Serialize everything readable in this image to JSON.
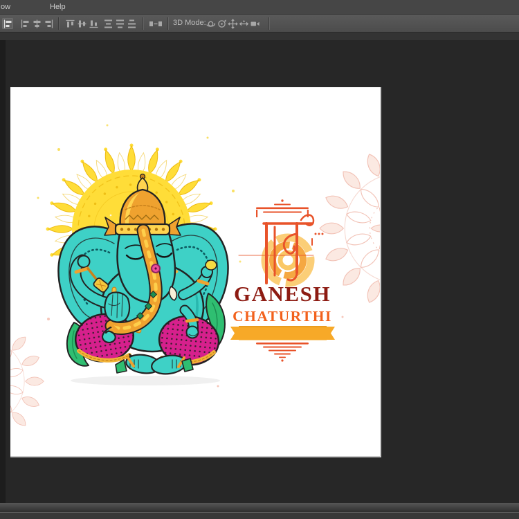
{
  "menu_bar": {
    "items": [
      {
        "label": "ow"
      },
      {
        "label": "Help"
      }
    ]
  },
  "options_bar": {
    "active_icon": "align-left-edges",
    "align_icons": [
      "align-left-edges",
      "align-horizontal-centers",
      "align-right-edges",
      "align-top-edges",
      "align-vertical-centers",
      "align-bottom-edges",
      "distribute-top-edges",
      "distribute-vertical-centers",
      "distribute-bottom-edges",
      "distribute-spacing"
    ],
    "three_d": {
      "label": "3D Mode:",
      "icons": [
        "orbit-3d-camera",
        "roll-3d-camera",
        "pan-3d-camera",
        "slide-3d-camera",
        "zoom-3d-camera"
      ]
    }
  },
  "canvas": {
    "artwork": {
      "greeting": {
        "line1": "GANESH",
        "line2": "CHATURTHI"
      },
      "shri_text": "श्री",
      "colors": {
        "teal": "#3ED1C6",
        "teal-dark": "#1FA9A2",
        "outline": "#232323",
        "sun": "#FFDD38",
        "sun-deep": "#EDBB12",
        "gold": "#EFA22F",
        "gold-light": "#FFD44F",
        "gold-deep": "#C9821C",
        "magenta": "#D6208C",
        "magenta-deep": "#A8156B",
        "green": "#2FBE71",
        "green-deep": "#1C8F52",
        "cream": "#F7EFD8",
        "gem": "#ED4E9C",
        "maroon": "#8D1B12",
        "orange": "#F2611C",
        "accent": "#E8532A",
        "banner": "#F7A928",
        "mpink": "#EFB3A4",
        "mpink-fill": "#FBE4DC"
      }
    }
  }
}
